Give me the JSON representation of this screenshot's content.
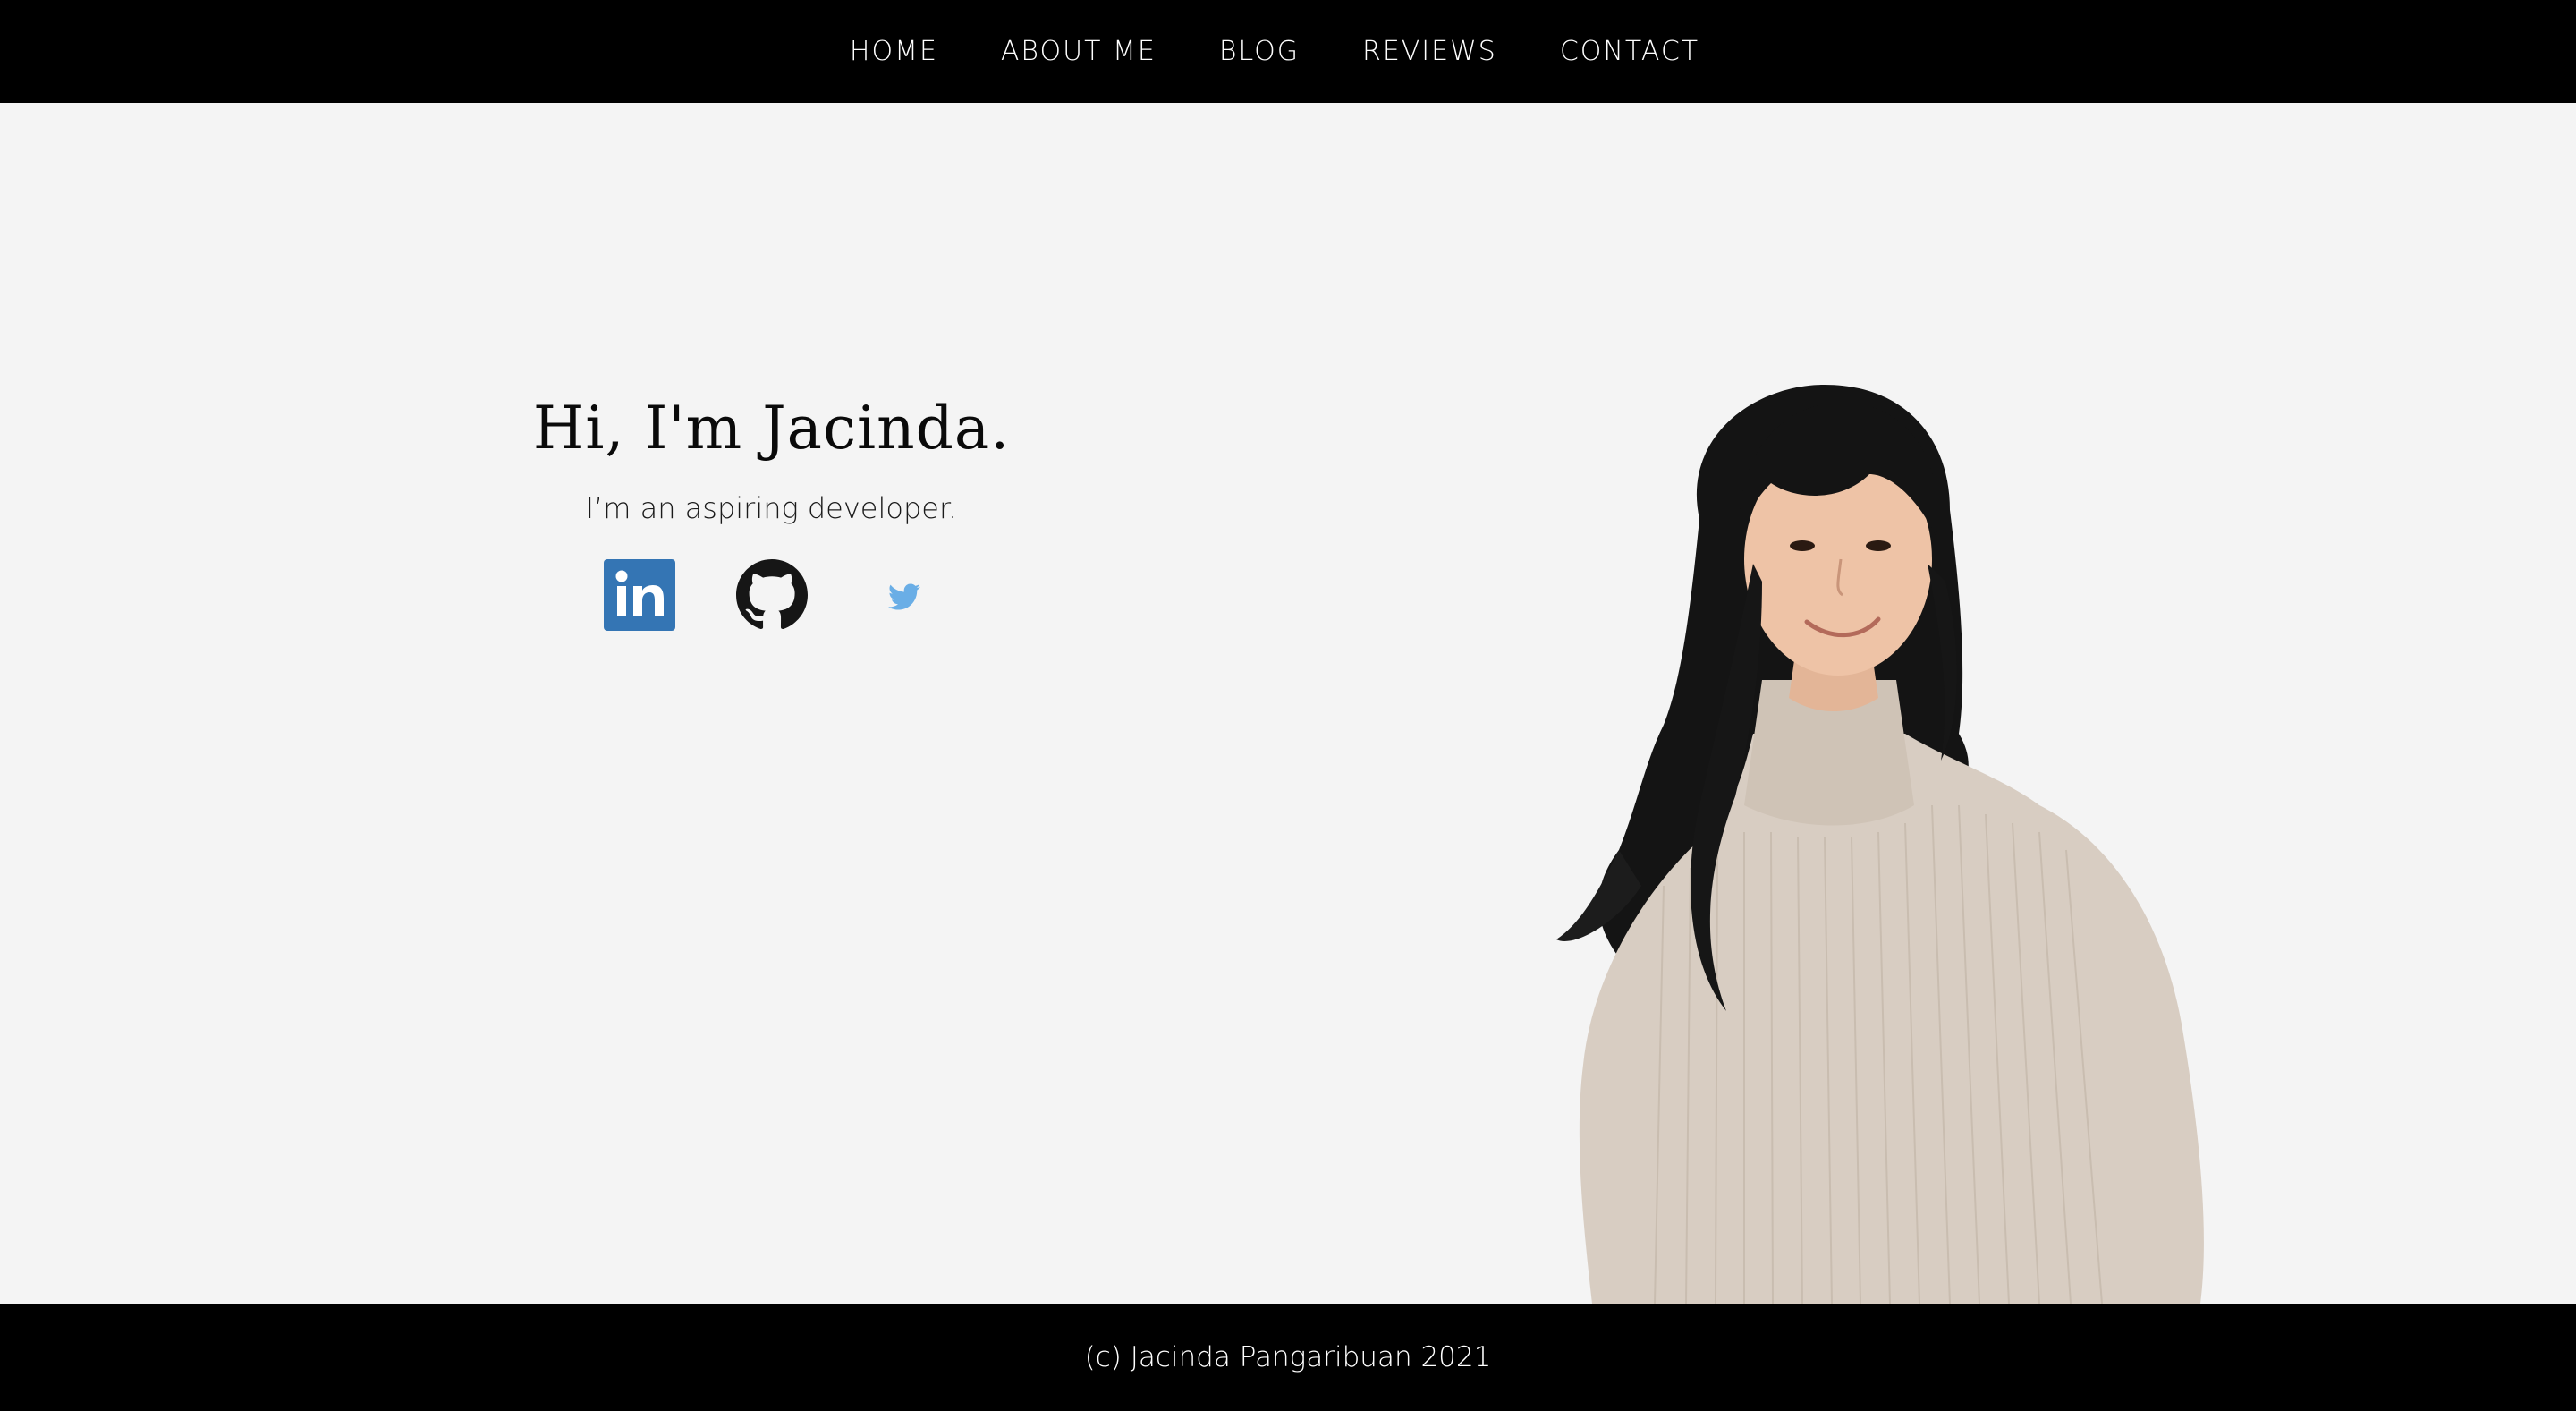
{
  "nav": {
    "items": [
      {
        "label": "HOME"
      },
      {
        "label": "ABOUT ME"
      },
      {
        "label": "BLOG"
      },
      {
        "label": "REVIEWS"
      },
      {
        "label": "CONTACT"
      }
    ]
  },
  "hero": {
    "title": "Hi, I'm Jacinda.",
    "subtitle": "I’m an aspiring developer.",
    "socials": [
      {
        "icon": "linkedin-icon",
        "color": "#3475b4"
      },
      {
        "icon": "github-icon",
        "color": "#161616"
      },
      {
        "icon": "twitter-icon",
        "color": "#6aaee6"
      }
    ]
  },
  "footer": {
    "text": "(c) Jacinda Pangaribuan 2021"
  },
  "colors": {
    "bar_background": "#000000",
    "page_background": "#f4f4f4"
  }
}
